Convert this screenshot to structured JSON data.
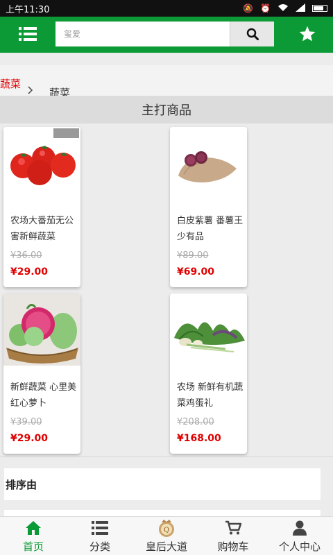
{
  "status_bar": {
    "time": "上午11:30"
  },
  "header": {
    "search_placeholder": "玺爱",
    "accent": "#0c9a36"
  },
  "breadcrumb": {
    "home": "蔬菜",
    "current": "蔬菜"
  },
  "section_title": "主打商品",
  "products": [
    {
      "name": "农场大番茄无公害新鲜蔬菜",
      "old_price": "¥36.00",
      "price": "¥29.00",
      "image": "tomato"
    },
    {
      "name": "白皮紫薯 番薯王 少有品",
      "old_price": "¥89.00",
      "price": "¥69.00",
      "image": "purple-sweet-potato"
    },
    {
      "name": "新鲜蔬菜 心里美红心萝卜",
      "old_price": "¥39.00",
      "price": "¥29.00",
      "image": "radish-basket"
    },
    {
      "name": "农场 新鲜有机蔬菜鸡蛋礼",
      "old_price": "¥208.00",
      "price": "¥168.00",
      "image": "organic-greens"
    }
  ],
  "sort_label": "排序由",
  "bottom_nav": [
    {
      "label": "首页",
      "icon": "home-icon",
      "active": true
    },
    {
      "label": "分类",
      "icon": "list-icon",
      "active": false
    },
    {
      "label": "皇后大道",
      "icon": "queen-logo-icon",
      "active": false
    },
    {
      "label": "购物车",
      "icon": "cart-icon",
      "active": false
    },
    {
      "label": "个人中心",
      "icon": "user-icon",
      "active": false
    }
  ]
}
